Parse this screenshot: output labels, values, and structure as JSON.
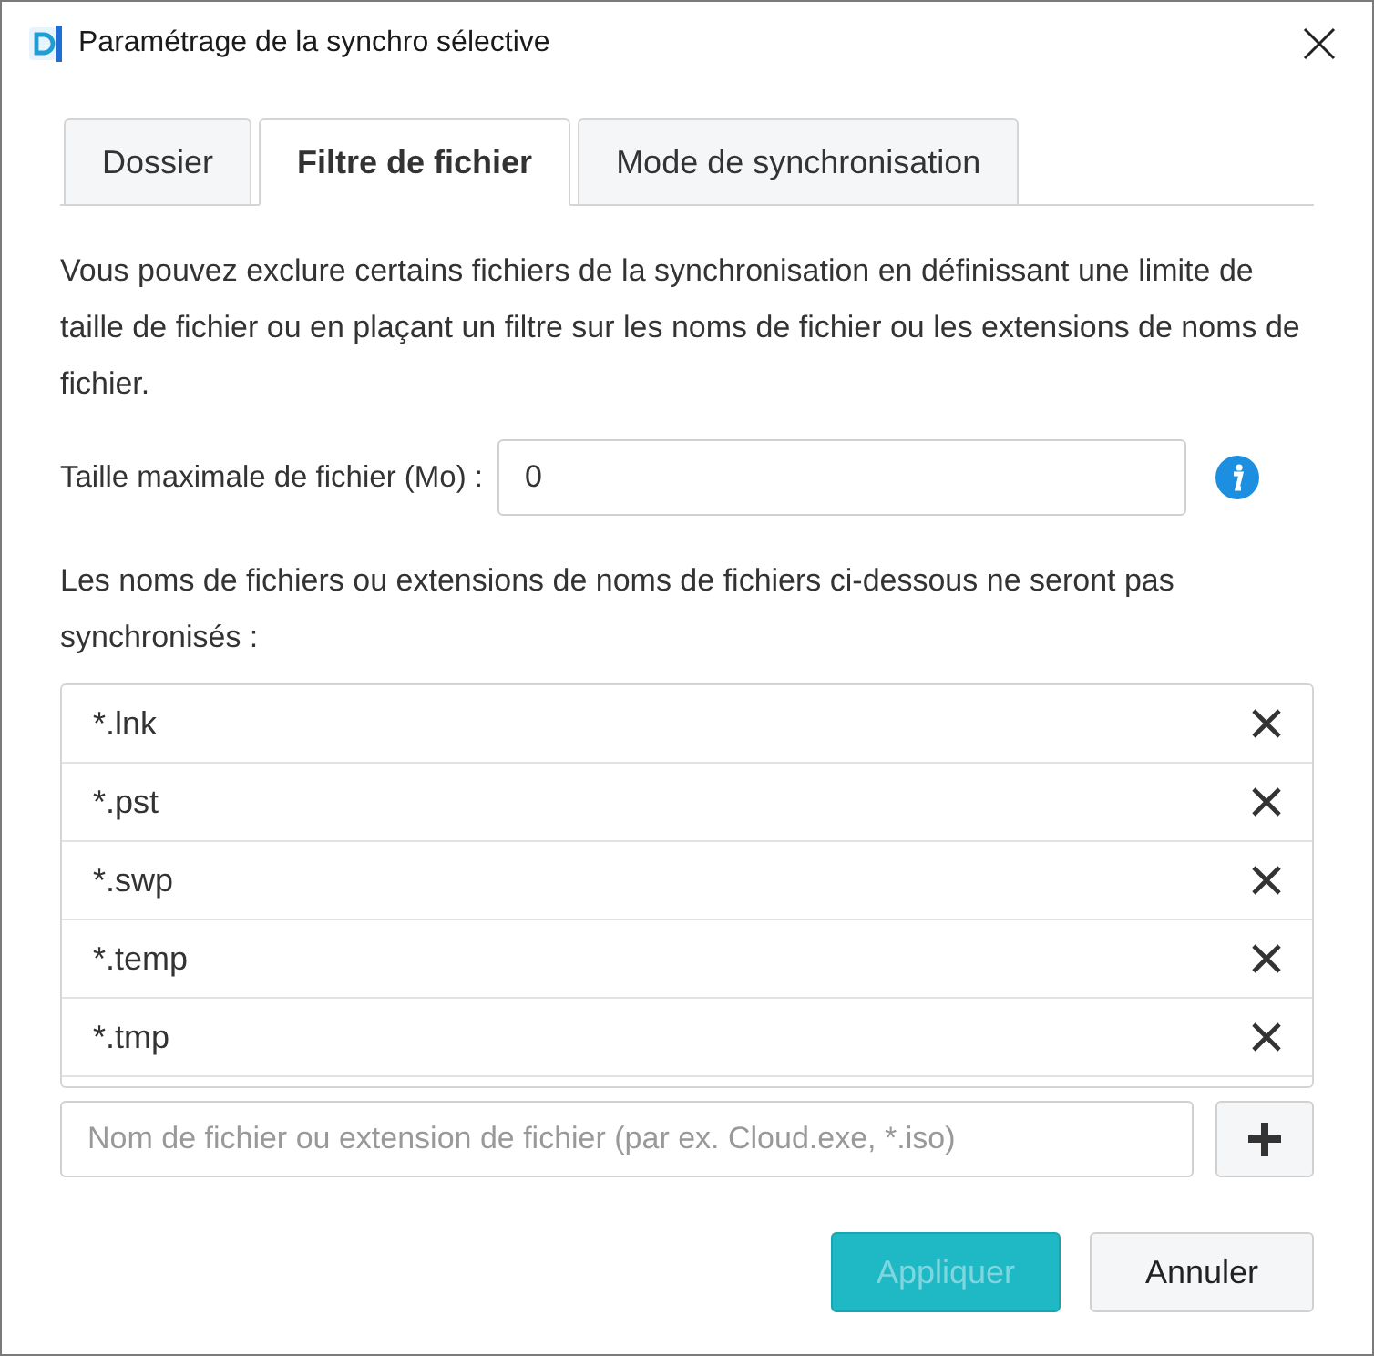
{
  "window": {
    "title": "Paramétrage de la synchro sélective"
  },
  "tabs": [
    {
      "label": "Dossier",
      "selected": false
    },
    {
      "label": "Filtre de fichier",
      "selected": true
    },
    {
      "label": "Mode de synchronisation",
      "selected": false
    }
  ],
  "description": "Vous pouvez exclure certains fichiers de la synchronisation en définissant une limite de taille de fichier ou en plaçant un filtre sur les noms de fichier ou les extensions de noms de fichier.",
  "max_size": {
    "label": "Taille maximale de fichier (Mo) :",
    "value": "0"
  },
  "exclusions_label": "Les noms de fichiers ou extensions de noms de fichiers ci-dessous ne seront pas synchronisés :",
  "exclusions": [
    {
      "pattern": "*.lnk"
    },
    {
      "pattern": "*.pst"
    },
    {
      "pattern": "*.swp"
    },
    {
      "pattern": "*.temp"
    },
    {
      "pattern": "*.tmp"
    }
  ],
  "new_exclusion": {
    "placeholder": "Nom de fichier ou extension de fichier (par ex. Cloud.exe, *.iso)"
  },
  "buttons": [
    {
      "label": "Appliquer",
      "kind": "primary",
      "disabled": true
    },
    {
      "label": "Annuler",
      "kind": "secondary",
      "disabled": false
    }
  ]
}
